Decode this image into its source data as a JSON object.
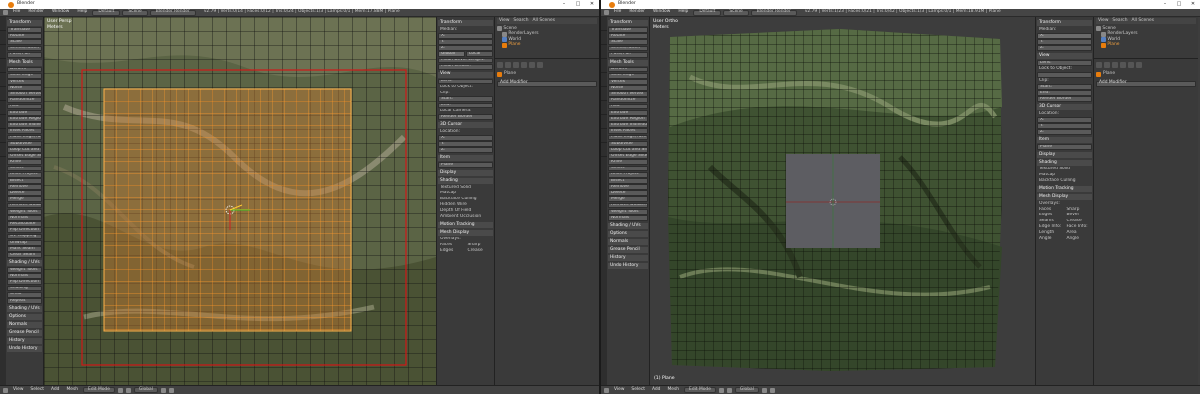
{
  "window1": {
    "title": "Blender",
    "controls": [
      "–",
      "□",
      "✕"
    ],
    "menu": [
      "File",
      "Render",
      "Window",
      "Help"
    ],
    "layout": "Default",
    "scene": "Scene",
    "render_engine": "Blender Render",
    "info": "v2.79 | Verts:0/14 | Faces:0/12 | Tris:0/24 | Objects:1/3 | Lamps:0/1 | Mem:17.88M | Plane",
    "viewport_label": "User Persp",
    "viewport_sub": "Meters",
    "tools": {
      "sections": [
        {
          "title": "Transform",
          "items": [
            "Translate",
            "Rotate",
            "Scale",
            "Shrink/Fatten",
            "Push/Pull"
          ]
        },
        {
          "title": "Mesh Tools",
          "items": [
            "Deform",
            "Slide Edge",
            "Vertex",
            "Noise",
            "Smooth Vertex",
            "Randomize",
            "Add",
            "Extrude",
            "Extrude Region",
            "Extrude Individual",
            "Inset Faces",
            "Make Edge/Face",
            "Subdivide",
            "Loop Cut and Slide",
            "Offset Edge Slide",
            "Knife",
            "Select",
            "Knife Project",
            "Bisect",
            "Remove",
            "Delete",
            "Merge",
            "Remove Doubles",
            "Weight Tools",
            "Normals",
            "Recalculate",
            "Flip Direction",
            "UV Mapping",
            "Unwrap",
            "Mark Seam",
            "Clear Seam"
          ]
        },
        {
          "title": "Shading / UVs",
          "items": [
            "Weight Tools",
            "Normals",
            "Flip Direction",
            "Shading",
            "Undo",
            "Repeat"
          ]
        }
      ],
      "toggles": [
        "Shading / UVs",
        "Options",
        "Normals",
        "Grease Pencil",
        "History",
        "Undo History"
      ]
    },
    "npanel": {
      "transform_header": "Transform",
      "median": "Median:",
      "axis": [
        "X:",
        "Y:",
        "Z:"
      ],
      "global_local": [
        "Global",
        "Local"
      ],
      "mean_bevel": "Mean Bevel Weight:",
      "mean_crease": "Mean Crease:",
      "view_header": "View",
      "lens": "Lens:",
      "lock_obj": "Lock to Object:",
      "clip": "Clip:",
      "start": "Start:",
      "end": "End:",
      "local_cam": "Local Camera:",
      "render_border": "Render Border",
      "cursor_header": "3D Cursor",
      "location": "Location:",
      "item_header": "Item",
      "item_name": "Plane",
      "display_header": "Display",
      "shading_header": "Shading",
      "textured_solid": "Textured Solid",
      "matcap": "Matcap",
      "backface": "Backface Culling",
      "hidden_wire": "Hidden Wire",
      "depth_of_field": "Depth Of Field",
      "ambient": "Ambient Occlusion",
      "motion_tracking": "Motion Tracking",
      "mesh_display": "Mesh Display",
      "overlays": "Overlays:",
      "faces": "Faces",
      "edges": "Edges",
      "seams": "Seams",
      "sharp": "Sharp",
      "crease": "Crease"
    },
    "outliner": {
      "header": [
        "View",
        "Search",
        "All Scenes"
      ],
      "items": [
        "Scene",
        "RenderLayers",
        "World",
        "Plane"
      ]
    },
    "properties": {
      "object": "Plane",
      "modifier": "Add Modifier"
    },
    "status": [
      "View",
      "Select",
      "Add",
      "Mesh"
    ],
    "status_mode": "Edit Mode",
    "status_pivot": "Global"
  },
  "window2": {
    "title": "Blender",
    "controls": [
      "–",
      "□",
      "✕"
    ],
    "menu": [
      "File",
      "Render",
      "Window",
      "Help"
    ],
    "layout": "Default",
    "scene": "Scene",
    "render_engine": "Blender Render",
    "info": "v2.79 | Verts:1/23 | Faces:0/21 | Tris:0/42 | Objects:1/3 | Lamps:0/1 | Mem:18.91M | Plane",
    "viewport_label": "User Ortho",
    "viewport_sub": "Meters",
    "tools": {
      "sections": [
        {
          "title": "Transform",
          "items": [
            "Translate",
            "Rotate",
            "Scale",
            "Shrink/Fatten",
            "Push/Pull"
          ]
        },
        {
          "title": "Mesh Tools",
          "items": [
            "Deform",
            "Slide Edge",
            "Vertex",
            "Noise",
            "Smooth Vertex",
            "Randomize",
            "Add",
            "Extrude",
            "Extrude Region",
            "Extrude Individual",
            "Inset Faces",
            "Make Edge/Face",
            "Subdivide",
            "Loop Cut and Slide",
            "Offset Edge Slide",
            "Knife",
            "Select",
            "Knife Project",
            "Bisect",
            "Remove",
            "Delete",
            "Merge",
            "Remove Doubles",
            "Weight Tools",
            "Normals"
          ]
        }
      ],
      "toggles": [
        "Shading / UVs",
        "Options",
        "Normals",
        "Grease Pencil",
        "History",
        "Undo History"
      ]
    },
    "npanel": {
      "transform_header": "Transform",
      "median": "Median:",
      "view_header": "View",
      "location": "Location:",
      "item_header": "Item",
      "item_name": "Plane",
      "display_header": "Display",
      "shading_header": "Shading",
      "motion_tracking": "Motion Tracking",
      "mesh_display": "Mesh Display",
      "overlays": "Overlays:",
      "faces": "Faces",
      "edges": "Edges",
      "seams": "Seams",
      "sharp": "Sharp",
      "crease": "Crease",
      "bevel": "Bevel",
      "edge_info": "Edge Info:",
      "face_info": "Face Info:",
      "length": "Length",
      "angle": "Angle",
      "area": "Area"
    },
    "outliner": {
      "header": [
        "View",
        "Search",
        "All Scenes"
      ],
      "items": [
        "Scene",
        "RenderLayers",
        "World",
        "Plane"
      ]
    },
    "properties": {
      "object": "Plane",
      "modifier": "Add Modifier"
    },
    "object_label": "(1) Plane",
    "status": [
      "View",
      "Select",
      "Add",
      "Mesh"
    ],
    "status_mode": "Edit Mode",
    "status_pivot": "Global"
  }
}
